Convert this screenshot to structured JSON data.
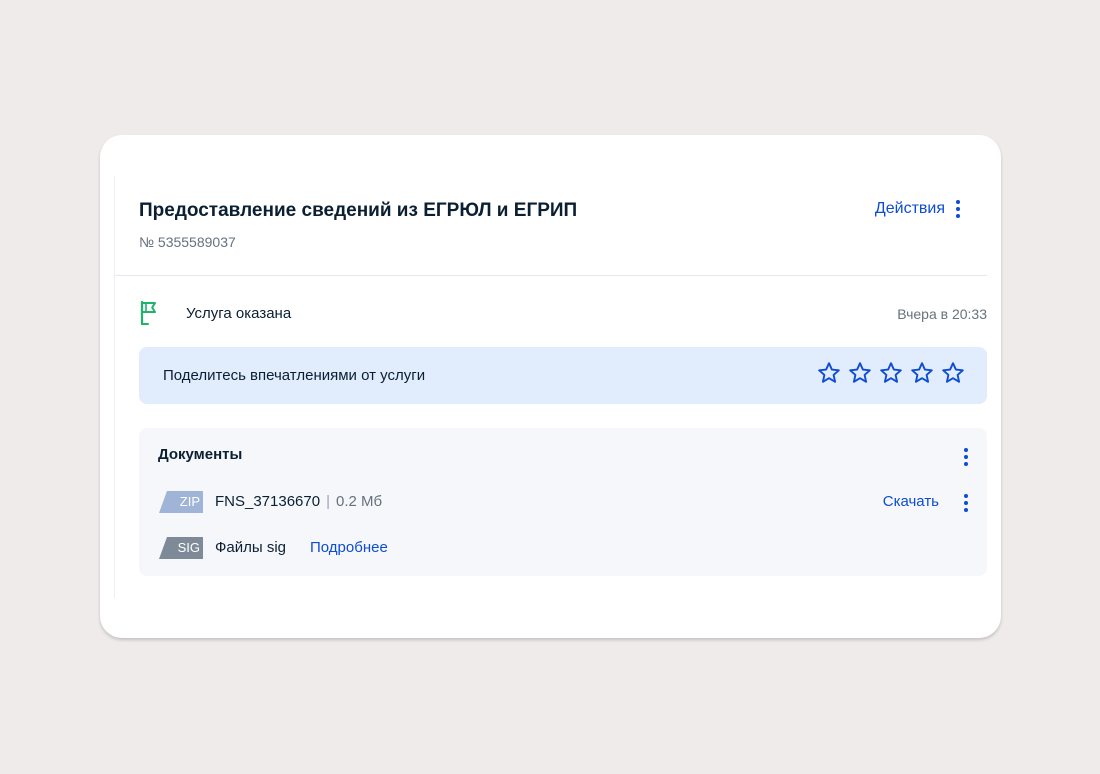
{
  "order": {
    "title": "Предоставление сведений из ЕГРЮЛ и ЕГРИП",
    "number": "№ 5355589037",
    "actions_label": "Действия"
  },
  "status": {
    "icon": "flag-icon",
    "text": "Услуга оказана",
    "time": "Вчера в 20:33",
    "color": "#1db56b"
  },
  "feedback": {
    "prompt": "Поделитесь впечатлениями от услуги",
    "stars_total": 5,
    "rating": 0
  },
  "documents": {
    "title": "Документы",
    "files": [
      {
        "badge": "ZIP",
        "name": "FNS_37136670",
        "separator": "|",
        "size": "0.2 Мб",
        "action": "Скачать"
      },
      {
        "badge": "SIG",
        "name": "Файлы sig",
        "link": "Подробнее"
      }
    ]
  },
  "colors": {
    "accent": "#0d4cd3",
    "feedback_bg": "#e1ecfc",
    "documents_bg": "#f5f7fa",
    "page_bg": "#efebea"
  }
}
